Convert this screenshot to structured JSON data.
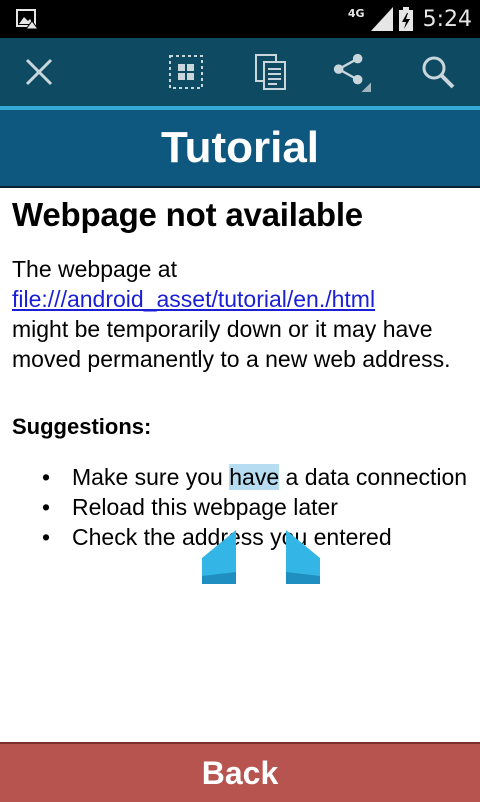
{
  "status_bar": {
    "network": "4G",
    "time": "5:24"
  },
  "action_bar": {
    "icons": [
      "close-icon",
      "select-all-icon",
      "copy-icon",
      "share-icon",
      "search-icon"
    ],
    "accent": "#35a9d6",
    "background": "#0f4a63"
  },
  "title_bar": {
    "title": "Tutorial",
    "background": "#0e587f"
  },
  "content": {
    "heading": "Webpage not available",
    "intro": "The webpage at",
    "url": "file:///android_asset/tutorial/en./html",
    "message": "might be temporarily down or it may have moved permanently to a new web address.",
    "suggestions_title": "Suggestions:",
    "suggestion_1_before": "Make sure you ",
    "suggestion_1_selected": "have",
    "suggestion_1_after": " a data connection",
    "suggestion_2": "Reload this webpage later",
    "suggestion_3": "Check the address you entered"
  },
  "bottom_bar": {
    "back_label": "Back",
    "background": "#b85450"
  }
}
